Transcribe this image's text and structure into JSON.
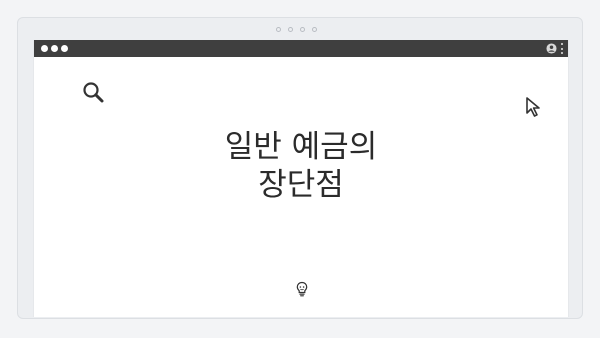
{
  "headline": {
    "line1": "일반 예금의",
    "line2": "장단점"
  },
  "icons": {
    "search": "search-icon",
    "cursor": "cursor-arrow-icon",
    "bulb": "lightbulb-icon",
    "user": "user-icon",
    "menu": "kebab-menu-icon"
  },
  "colors": {
    "titlebar": "#3f3f3f",
    "background": "#f3f4f6",
    "window": "#ffffff",
    "text": "#2b2b2b"
  }
}
